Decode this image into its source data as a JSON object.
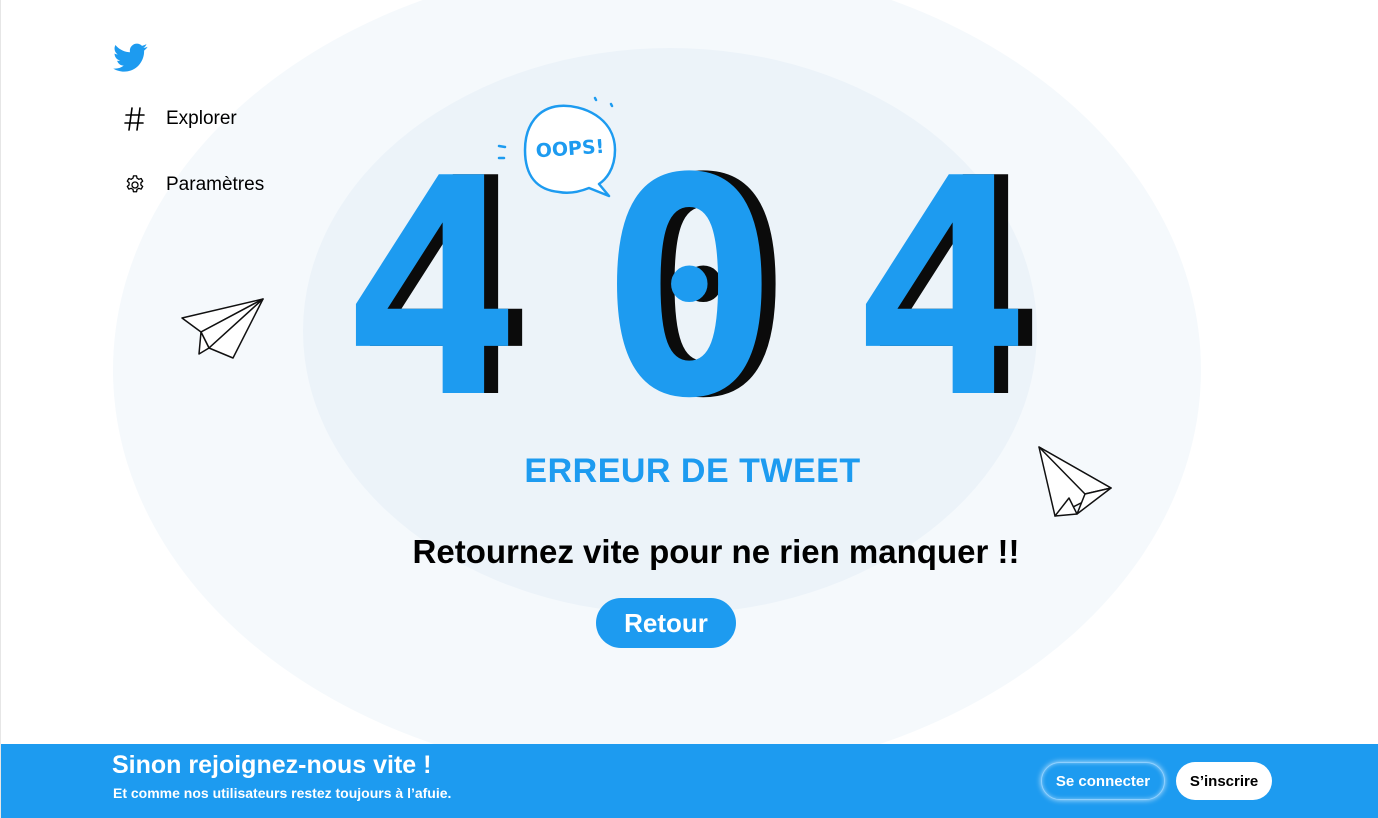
{
  "brand": {
    "logo_icon": "twitter-bird-icon",
    "accent_color": "#1d9bf0"
  },
  "nav": {
    "items": [
      {
        "label": "Explorer",
        "icon": "hashtag-icon"
      },
      {
        "label": "Paramètres",
        "icon": "gear-icon"
      }
    ]
  },
  "error": {
    "digits": [
      "4",
      "0",
      "4"
    ],
    "bubble_text": "OOPS!",
    "title": "ERREUR DE TWEET",
    "tagline": "Retournez vite pour ne rien manquer !!",
    "back_label": "Retour"
  },
  "decor": {
    "left_icon": "paper-plane-icon",
    "right_icon": "paper-plane-icon"
  },
  "bottom_bar": {
    "title": "Sinon rejoignez-nous vite !",
    "subtitle": "Et comme nos utilisateurs restez toujours à l’afuie.",
    "login_label": "Se connecter",
    "signup_label": "S’inscrire"
  }
}
